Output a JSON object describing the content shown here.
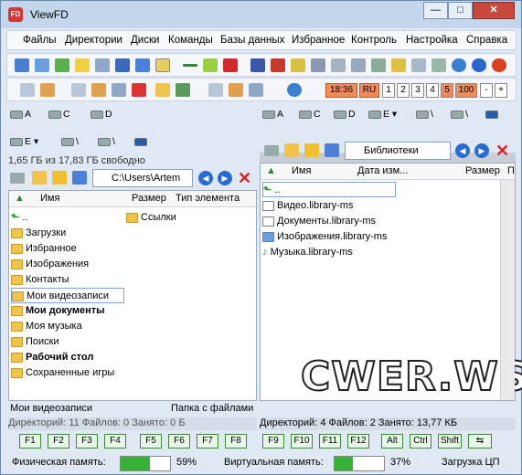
{
  "window": {
    "title": "ViewFD",
    "app_icon_text": "FD",
    "minimize": "—",
    "maximize": "□",
    "close": "✕"
  },
  "menu": [
    "Файлы",
    "Директории",
    "Диски",
    "Команды",
    "Базы данных",
    "Избранное",
    "Контроль",
    "Настройка",
    "Справка"
  ],
  "toolbar2": {
    "time": "18:36",
    "lang": "RU",
    "nums": [
      "1",
      "2",
      "3",
      "4",
      "5"
    ],
    "zoom": "100",
    "minus": "-",
    "plus": "+"
  },
  "drives_left": {
    "a": "A",
    "c": "C",
    "d": "D",
    "e": "E",
    "net": "\\"
  },
  "drives_right": {
    "a": "A",
    "c": "C",
    "d": "D",
    "e": "E",
    "net": "\\"
  },
  "left_panel": {
    "free_space": "1,65 ГБ из 17,83 ГБ свободно",
    "path": "C:\\Users\\Artem",
    "columns": {
      "name": "Имя",
      "size": "Размер",
      "type": "Тип элемента"
    },
    "items": [
      {
        "name": "..",
        "bold": false
      },
      {
        "name": "Загрузки",
        "bold": false
      },
      {
        "name": "Избранное",
        "bold": false
      },
      {
        "name": "Изображения",
        "bold": false
      },
      {
        "name": "Контакты",
        "bold": false
      },
      {
        "name": "Мои видеозаписи",
        "bold": false
      },
      {
        "name": "Мои документы",
        "bold": true
      },
      {
        "name": "Моя музыка",
        "bold": false
      },
      {
        "name": "Поиски",
        "bold": false
      },
      {
        "name": "Рабочий стол",
        "bold": true
      },
      {
        "name": "Сохраненные игры",
        "bold": false
      }
    ],
    "col2_item": "Ссылки",
    "status_name": "Мои видеозаписи",
    "status_type": "Папка с файлами",
    "summary": "Директорий: 11   Файлов: 0   Занято: 0 Б"
  },
  "right_panel": {
    "path": "Библиотеки",
    "columns": {
      "name": "Имя",
      "date": "Дата изм...",
      "size": "Размер",
      "extra": "П"
    },
    "items": [
      {
        "name": ".."
      },
      {
        "name": "Видео.library-ms"
      },
      {
        "name": "Документы.library-ms"
      },
      {
        "name": "Изображения.library-ms"
      },
      {
        "name": "Музыка.library-ms"
      }
    ],
    "summary": "Директорий: 4   Файлов: 2   Занято: 13,77 КБ"
  },
  "fkeys": [
    "F1",
    "F2",
    "F3",
    "F4",
    "F5",
    "F6",
    "F7",
    "F8",
    "F9",
    "F10",
    "F11",
    "F12",
    "Alt",
    "Ctrl",
    "Shift"
  ],
  "bottom": {
    "phys_label": "Физическая память:",
    "phys_pct": "59%",
    "phys_fraction": 0.59,
    "virt_label": "Виртуальная память:",
    "virt_pct": "37%",
    "virt_fraction": 0.37,
    "cpu_label": "Загрузка ЦП"
  },
  "watermark": "CWER.WS"
}
